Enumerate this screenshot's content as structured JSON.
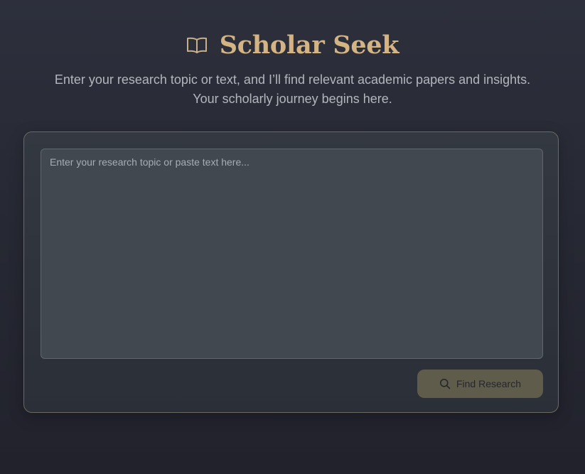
{
  "header": {
    "icon": "book-open-icon",
    "title": "Scholar Seek"
  },
  "subtitle": {
    "line1": "Enter your research topic or text, and I’ll find relevant academic papers and insights.",
    "line2": "Your scholarly journey begins here."
  },
  "search": {
    "placeholder": "Enter your research topic or paste text here...",
    "value": "",
    "button_label": "Find Research",
    "button_icon": "search-icon"
  },
  "colors": {
    "accent": "#d4b483",
    "background": "#272a34",
    "card_border": "#6b6a60",
    "button": "#5f5c4c"
  }
}
